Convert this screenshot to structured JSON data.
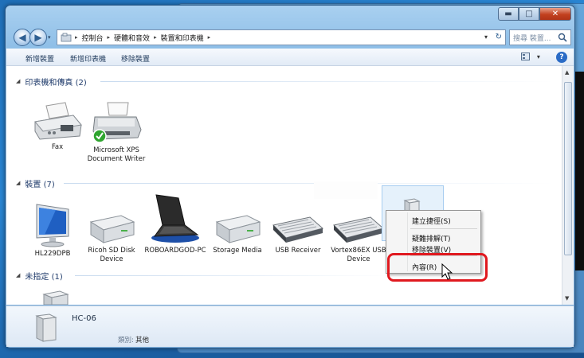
{
  "window": {
    "controls": {
      "minimize": "▬",
      "maximize": "□",
      "close": "✕"
    }
  },
  "address": {
    "back": "◀",
    "forward": "▶",
    "history": "▾",
    "crumbs": [
      "控制台",
      "硬體和音效",
      "裝置和印表機"
    ],
    "separator": "▸",
    "dropdown": "▾",
    "refresh": "↻",
    "search_placeholder": "搜尋 裝置..."
  },
  "toolbar": {
    "add_device": "新增裝置",
    "add_printer": "新增印表機",
    "remove_device": "移除裝置",
    "view_dropdown": "▾",
    "help": "?"
  },
  "groups": {
    "printers": {
      "expander": "◢",
      "label": "印表機和傳真 (2)"
    },
    "devices": {
      "expander": "◢",
      "label": "裝置 (7)"
    },
    "unspecified": {
      "expander": "◢",
      "label": "未指定 (1)"
    }
  },
  "printers": [
    {
      "label": "Fax",
      "icon": "fax-icon"
    },
    {
      "label": "Microsoft XPS Document Writer",
      "icon": "printer-icon",
      "default": true
    }
  ],
  "devices": [
    {
      "label": "HL229DPB",
      "icon": "monitor-icon"
    },
    {
      "label": "Ricoh SD Disk Device",
      "icon": "drive-icon"
    },
    {
      "label": "ROBOARDGOD-PC",
      "icon": "laptop-icon"
    },
    {
      "label": "Storage Media",
      "icon": "drive-icon"
    },
    {
      "label": "USB Receiver",
      "icon": "keyboard-icon"
    },
    {
      "label": "Vortex86EX USB Device",
      "icon": "keyboard-icon"
    }
  ],
  "context_menu": {
    "items": [
      "建立捷徑(S)",
      "疑難排解(T)",
      "移除裝置(V)",
      "內容(R)"
    ]
  },
  "details": {
    "name": "HC-06",
    "category_label": "類別:",
    "category_value": "其他"
  },
  "scrollbar": {
    "up": "▲",
    "down": "▼"
  },
  "colors": {
    "highlight_ring": "#e0191f",
    "selection": "#e5f1fb",
    "link_text": "#1e3a6a"
  }
}
